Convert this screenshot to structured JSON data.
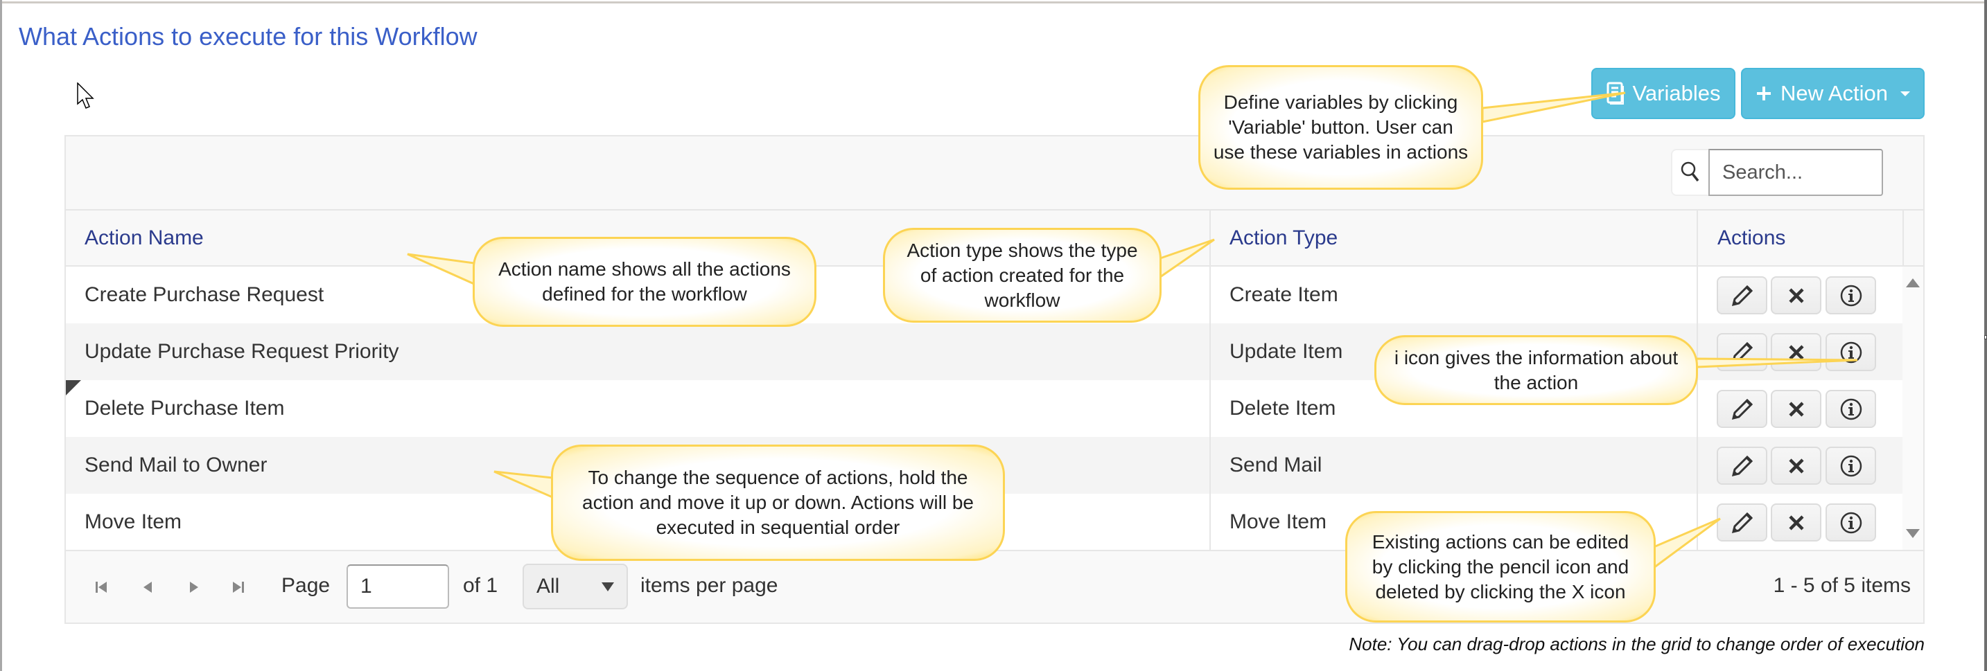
{
  "page": {
    "title": "What Actions to execute for this Workflow"
  },
  "toolbar": {
    "variables_label": "Variables",
    "variables_icon": "book-icon",
    "new_action_label": "New Action",
    "new_action_icon": "plus-icon",
    "search_placeholder": "Search...",
    "search_value": ""
  },
  "grid": {
    "columns": [
      "Action Name",
      "Action Type",
      "Actions"
    ],
    "rows": [
      {
        "name": "Create Purchase Request",
        "type": "Create Item"
      },
      {
        "name": "Update Purchase Request Priority",
        "type": "Update Item"
      },
      {
        "name": "Delete Purchase Item",
        "type": "Delete Item"
      },
      {
        "name": "Send Mail to Owner",
        "type": "Send Mail"
      },
      {
        "name": "Move Item",
        "type": "Move Item"
      }
    ],
    "row_action_icons": [
      "pencil-icon",
      "close-icon",
      "info-icon"
    ]
  },
  "pager": {
    "page_label": "Page",
    "page_value": "1",
    "of_label": "of 1",
    "per_page_value": "All",
    "per_page_label": "items per page",
    "summary": "1 - 5 of 5 items"
  },
  "note": "Note: You can drag-drop actions in the grid to change order of execution",
  "callouts": {
    "variables": "Define variables by clicking 'Variable' button. User can use these variables in actions",
    "action_name": "Action name shows all the actions defined for the workflow",
    "action_type": "Action type shows the type of action created for the workflow",
    "info_icon": "i icon gives the information about the action",
    "sequence": "To change the sequence of actions, hold the action and move it up or down. Actions will be executed in sequential order",
    "edit_delete": "Existing actions can be edited by clicking the pencil icon and deleted by clicking the X icon"
  },
  "colors": {
    "title": "#3a5fc8",
    "header_text": "#2a3a8c",
    "button_info": "#5bc0de",
    "callout_border": "#fcd454"
  }
}
